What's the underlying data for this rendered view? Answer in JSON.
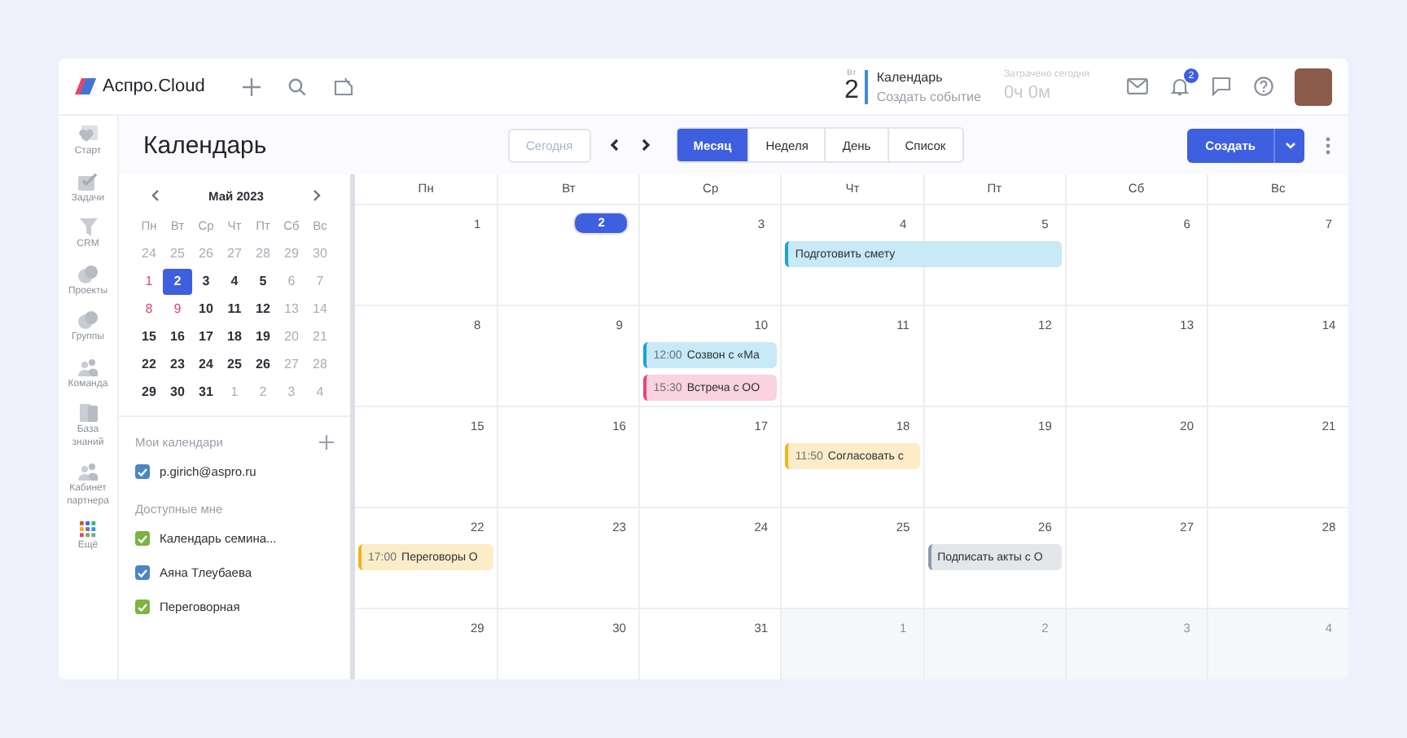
{
  "app": {
    "logo": "Аспро.Cloud"
  },
  "date_widget": {
    "weekday": "Вт",
    "day": "2",
    "title": "Календарь",
    "action": "Создать событие"
  },
  "time_spent": {
    "label": "Затрачено сегодня",
    "value": "0ч 0м"
  },
  "notifications": {
    "badge": "2"
  },
  "rail": [
    {
      "kind": "start",
      "label": "Старт"
    },
    {
      "kind": "tasks",
      "label": "Задачи"
    },
    {
      "kind": "crm",
      "label": "CRM"
    },
    {
      "kind": "projects",
      "label": "Проекты"
    },
    {
      "kind": "groups",
      "label": "Группы"
    },
    {
      "kind": "team",
      "label": "Команда"
    },
    {
      "kind": "knowledge",
      "label": "База знаний"
    },
    {
      "kind": "partner",
      "label": "Кабинет партнера"
    },
    {
      "kind": "more",
      "label": "Ещё"
    }
  ],
  "page": {
    "title": "Календарь"
  },
  "today_button": {
    "label": "Сегодня",
    "disabled": true
  },
  "views": [
    {
      "label": "Месяц",
      "selected": true
    },
    {
      "label": "Неделя",
      "selected": false
    },
    {
      "label": "День",
      "selected": false
    },
    {
      "label": "Список",
      "selected": false
    }
  ],
  "create_button": {
    "label": "Создать"
  },
  "mini_calendar": {
    "title": "Май 2023",
    "weekdays": [
      "Пн",
      "Вт",
      "Ср",
      "Чт",
      "Пт",
      "Сб",
      "Вс"
    ],
    "weeks": [
      [
        {
          "label": "24",
          "kind": "other",
          "selected": false
        },
        {
          "label": "25",
          "kind": "other",
          "selected": false
        },
        {
          "label": "26",
          "kind": "other",
          "selected": false
        },
        {
          "label": "27",
          "kind": "other",
          "selected": false
        },
        {
          "label": "28",
          "kind": "other",
          "selected": false
        },
        {
          "label": "29",
          "kind": "other",
          "selected": false
        },
        {
          "label": "30",
          "kind": "other",
          "selected": false
        }
      ],
      [
        {
          "label": "1",
          "kind": "holiday",
          "selected": false
        },
        {
          "label": "2",
          "kind": "normal",
          "selected": true
        },
        {
          "label": "3",
          "kind": "normal",
          "selected": false
        },
        {
          "label": "4",
          "kind": "normal",
          "selected": false
        },
        {
          "label": "5",
          "kind": "normal",
          "selected": false
        },
        {
          "label": "6",
          "kind": "weekend",
          "selected": false
        },
        {
          "label": "7",
          "kind": "weekend",
          "selected": false
        }
      ],
      [
        {
          "label": "8",
          "kind": "holiday",
          "selected": false
        },
        {
          "label": "9",
          "kind": "holiday",
          "selected": false
        },
        {
          "label": "10",
          "kind": "normal",
          "selected": false
        },
        {
          "label": "11",
          "kind": "normal",
          "selected": false
        },
        {
          "label": "12",
          "kind": "normal",
          "selected": false
        },
        {
          "label": "13",
          "kind": "weekend",
          "selected": false
        },
        {
          "label": "14",
          "kind": "weekend",
          "selected": false
        }
      ],
      [
        {
          "label": "15",
          "kind": "normal",
          "selected": false
        },
        {
          "label": "16",
          "kind": "normal",
          "selected": false
        },
        {
          "label": "17",
          "kind": "normal",
          "selected": false
        },
        {
          "label": "18",
          "kind": "normal",
          "selected": false
        },
        {
          "label": "19",
          "kind": "normal",
          "selected": false
        },
        {
          "label": "20",
          "kind": "weekend",
          "selected": false
        },
        {
          "label": "21",
          "kind": "weekend",
          "selected": false
        }
      ],
      [
        {
          "label": "22",
          "kind": "normal",
          "selected": false
        },
        {
          "label": "23",
          "kind": "normal",
          "selected": false
        },
        {
          "label": "24",
          "kind": "normal",
          "selected": false
        },
        {
          "label": "25",
          "kind": "normal",
          "selected": false
        },
        {
          "label": "26",
          "kind": "normal",
          "selected": false
        },
        {
          "label": "27",
          "kind": "weekend",
          "selected": false
        },
        {
          "label": "28",
          "kind": "weekend",
          "selected": false
        }
      ],
      [
        {
          "label": "29",
          "kind": "normal",
          "selected": false
        },
        {
          "label": "30",
          "kind": "normal",
          "selected": false
        },
        {
          "label": "31",
          "kind": "normal",
          "selected": false
        },
        {
          "label": "1",
          "kind": "other",
          "selected": false
        },
        {
          "label": "2",
          "kind": "other",
          "selected": false
        },
        {
          "label": "3",
          "kind": "other",
          "selected": false
        },
        {
          "label": "4",
          "kind": "other",
          "selected": false
        }
      ]
    ]
  },
  "my_calendars": {
    "title": "Мои календари",
    "items": [
      {
        "label": "p.girich@aspro.ru",
        "checked": true,
        "color": "#4a86c5"
      }
    ]
  },
  "shared_calendars": {
    "title": "Доступные мне",
    "items": [
      {
        "label": "Календарь семина...",
        "checked": true,
        "color": "#7cb342"
      },
      {
        "label": "Аяна Тлеубаева",
        "checked": true,
        "color": "#4a86c5"
      },
      {
        "label": "Переговорная",
        "checked": true,
        "color": "#7cb342"
      }
    ]
  },
  "month": {
    "weekdays": [
      "Пн",
      "Вт",
      "Ср",
      "Чт",
      "Пт",
      "Сб",
      "Вс"
    ],
    "weeks": [
      {
        "days": [
          {
            "label": "1",
            "other_month": false,
            "today": false
          },
          {
            "label": "2",
            "other_month": false,
            "today": true
          },
          {
            "label": "3",
            "other_month": false,
            "today": false
          },
          {
            "label": "4",
            "other_month": false,
            "today": false,
            "events": [
              {
                "kind": "start",
                "title": "Подготовить смету",
                "color": "#1aa3d9"
              }
            ]
          },
          {
            "label": "5",
            "other_month": false,
            "today": false,
            "events": [
              {
                "kind": "end"
              }
            ]
          },
          {
            "label": "6",
            "other_month": false,
            "today": false
          },
          {
            "label": "7",
            "other_month": false,
            "today": false
          }
        ]
      },
      {
        "days": [
          {
            "label": "8",
            "other_month": false,
            "today": false
          },
          {
            "label": "9",
            "other_month": false,
            "today": false
          },
          {
            "label": "10",
            "other_month": false,
            "today": false,
            "events": [
              {
                "kind": "single",
                "time": "12:00",
                "title": "Созвон с «Ма",
                "color": "#1aa3d9"
              },
              {
                "kind": "single",
                "time": "15:30",
                "title": "Встреча с ОО",
                "color": "#e5467a"
              }
            ]
          },
          {
            "label": "11",
            "other_month": false,
            "today": false
          },
          {
            "label": "12",
            "other_month": false,
            "today": false
          },
          {
            "label": "13",
            "other_month": false,
            "today": false
          },
          {
            "label": "14",
            "other_month": false,
            "today": false
          }
        ]
      },
      {
        "days": [
          {
            "label": "15",
            "other_month": false,
            "today": false
          },
          {
            "label": "16",
            "other_month": false,
            "today": false
          },
          {
            "label": "17",
            "other_month": false,
            "today": false
          },
          {
            "label": "18",
            "other_month": false,
            "today": false,
            "events": [
              {
                "kind": "single",
                "time": "11:50",
                "title": "Согласовать с",
                "color": "#f2b31b"
              }
            ]
          },
          {
            "label": "19",
            "other_month": false,
            "today": false
          },
          {
            "label": "20",
            "other_month": false,
            "today": false
          },
          {
            "label": "21",
            "other_month": false,
            "today": false
          }
        ]
      },
      {
        "days": [
          {
            "label": "22",
            "other_month": false,
            "today": false,
            "events": [
              {
                "kind": "single",
                "time": "17:00",
                "title": "Переговоры О",
                "color": "#f2b31b"
              }
            ]
          },
          {
            "label": "23",
            "other_month": false,
            "today": false
          },
          {
            "label": "24",
            "other_month": false,
            "today": false
          },
          {
            "label": "25",
            "other_month": false,
            "today": false
          },
          {
            "label": "26",
            "other_month": false,
            "today": false,
            "events": [
              {
                "kind": "single",
                "title": "Подписать акты с О",
                "color": "#8d99a8"
              }
            ]
          },
          {
            "label": "27",
            "other_month": false,
            "today": false
          },
          {
            "label": "28",
            "other_month": false,
            "today": false
          }
        ]
      },
      {
        "days": [
          {
            "label": "29",
            "other_month": false,
            "today": false
          },
          {
            "label": "30",
            "other_month": false,
            "today": false
          },
          {
            "label": "31",
            "other_month": false,
            "today": false
          },
          {
            "label": "1",
            "other_month": true,
            "today": false
          },
          {
            "label": "2",
            "other_month": true,
            "today": false
          },
          {
            "label": "3",
            "other_month": true,
            "today": false
          },
          {
            "label": "4",
            "other_month": true,
            "today": false
          }
        ]
      }
    ]
  }
}
